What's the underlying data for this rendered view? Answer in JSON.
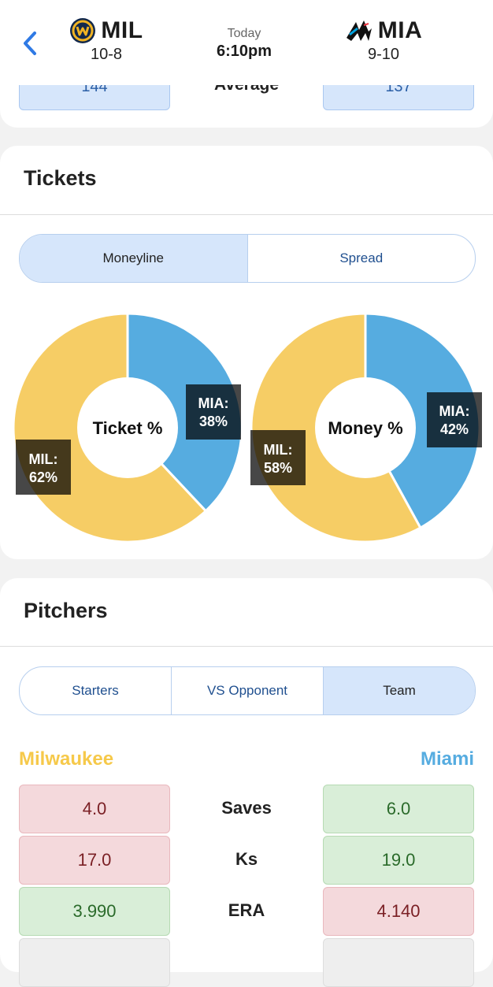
{
  "header": {
    "away": {
      "abbr": "MIL",
      "record": "10-8",
      "color": "#f0b323"
    },
    "home": {
      "abbr": "MIA",
      "record": "9-10",
      "color": "#00a3e0"
    },
    "day": "Today",
    "time": "6:10pm"
  },
  "top_card": {
    "left_value": "144",
    "middle_label": "Average",
    "right_value": "137"
  },
  "tickets": {
    "title": "Tickets",
    "tabs": [
      "Moneyline",
      "Spread"
    ],
    "active_tab": "Moneyline",
    "ticket_chart": {
      "center": "Ticket %",
      "mil_label": "MIL:",
      "mil_value": "62%",
      "mia_label": "MIA:",
      "mia_value": "38%"
    },
    "money_chart": {
      "center": "Money %",
      "mil_label": "MIL:",
      "mil_value": "58%",
      "mia_label": "MIA:",
      "mia_value": "42%"
    }
  },
  "chart_data": [
    {
      "type": "pie",
      "title": "Ticket %",
      "categories": [
        "MIL",
        "MIA"
      ],
      "values": [
        62,
        38
      ],
      "colors": [
        "#f6cd65",
        "#56ace0"
      ]
    },
    {
      "type": "pie",
      "title": "Money %",
      "categories": [
        "MIL",
        "MIA"
      ],
      "values": [
        58,
        42
      ],
      "colors": [
        "#f6cd65",
        "#56ace0"
      ]
    }
  ],
  "pitchers": {
    "title": "Pitchers",
    "tabs": [
      "Starters",
      "VS Opponent",
      "Team"
    ],
    "active_tab": "Team",
    "left_team": "Milwaukee",
    "right_team": "Miami",
    "left_color": "#f6c94a",
    "right_color": "#56ace0",
    "rows": [
      {
        "stat": "Saves",
        "left": "4.0",
        "right": "6.0",
        "left_state": "red",
        "right_state": "green"
      },
      {
        "stat": "Ks",
        "left": "17.0",
        "right": "19.0",
        "left_state": "red",
        "right_state": "green"
      },
      {
        "stat": "ERA",
        "left": "3.990",
        "right": "4.140",
        "left_state": "green",
        "right_state": "red"
      }
    ]
  }
}
